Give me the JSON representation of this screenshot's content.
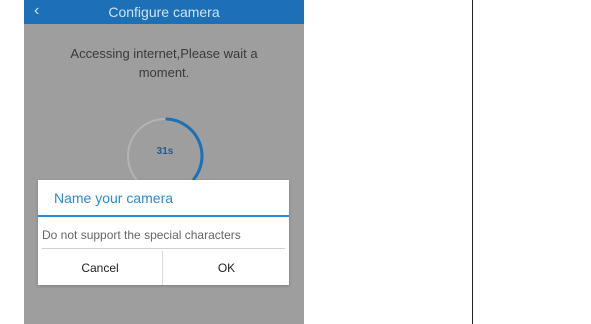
{
  "header": {
    "title": "Configure camera",
    "back_icon": "chevron-left-icon"
  },
  "status": {
    "message": "Accessing internet,Please wait a moment."
  },
  "progress": {
    "countdown_label": "31s",
    "fraction": 0.35,
    "color": "#1d6fb6"
  },
  "dialog": {
    "title": "Name your camera",
    "input_value": "",
    "input_placeholder": "Do not support the special characters",
    "cancel_label": "Cancel",
    "ok_label": "OK",
    "accent": "#2a8ad4"
  }
}
